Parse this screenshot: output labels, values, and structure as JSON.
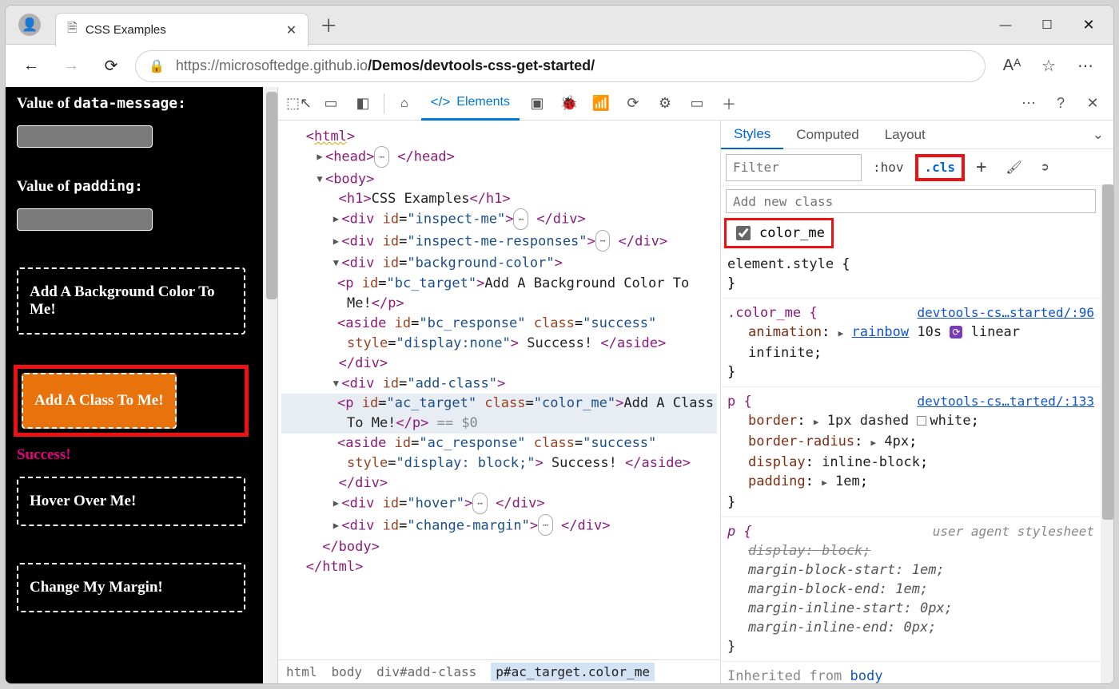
{
  "window": {
    "tab_title": "CSS Examples",
    "minimize_glyph": "—",
    "maximize_glyph": "☐",
    "close_glyph": "✕"
  },
  "addr": {
    "url_host": "https://microsoftedge.github.io",
    "url_path": "/Demos/devtools-css-get-started/",
    "back": "←",
    "forward": "→",
    "refresh": "⟳",
    "lock": "🔒",
    "read": "Aᴬ",
    "star": "☆",
    "menu": "⋯"
  },
  "page": {
    "val_data_message_label_a": "Value of ",
    "val_data_message_label_b": "data-message:",
    "val_padding_label_a": "Value of ",
    "val_padding_label_b": "padding:",
    "bg_box": "Add A Background Color To Me!",
    "class_box": "Add A Class To Me!",
    "success": "Success!",
    "hover_box": "Hover Over Me!",
    "margin_box": "Change My Margin!"
  },
  "devtools": {
    "tabs": {
      "elements": "Elements"
    },
    "breadcrumb": [
      "html",
      "body",
      "div#add-class",
      "p#ac_target.color_me"
    ]
  },
  "dom": {
    "html_open": "<html>",
    "head_open": "<head>",
    "head_close": "</head>",
    "body_open": "<body>",
    "h1": "<h1>CSS Examples</h1>",
    "inspect_me_open": "<div id=\"inspect-me\">",
    "inspect_me_close": "</div>",
    "inspect_resp_open": "<div id=\"inspect-me-responses\">",
    "inspect_resp_close": "</div>",
    "bg_open": "<div id=\"background-color\">",
    "bc_p_open": "<p id=\"bc_target\">",
    "bc_p_text": "Add A Background Color To Me!",
    "bc_p_close": "</p>",
    "bc_aside_open": "<aside id=\"bc_response\" class=\"success\" style=\"display:none\">",
    "bc_aside_text": " Success! ",
    "bc_aside_close": "</aside>",
    "div_close": "</div>",
    "ac_open": "<div id=\"add-class\">",
    "ac_p_open": "<p id=\"ac_target\" class=\"color_me\">",
    "ac_p_text": "Add A Class To Me!",
    "ac_p_close": "</p>",
    "eq0": " == $0",
    "ac_aside_open": "<aside id=\"ac_response\" class=\"success\" style=\"display: block;\">",
    "ac_aside_text": " Success! ",
    "ac_aside_close": "</aside>",
    "hover_open": "<div id=\"hover\">",
    "cm_open": "<div id=\"change-margin\">",
    "body_close": "</body>",
    "html_close": "</html>"
  },
  "styles": {
    "tabs": {
      "styles": "Styles",
      "computed": "Computed",
      "layout": "Layout"
    },
    "filter_placeholder": "Filter",
    "hov": ":hov",
    "cls": ".cls",
    "plus": "+",
    "add_class_placeholder": "Add new class",
    "class_check_label": "color_me",
    "element_style": "element.style {",
    "brace_close": "}",
    "colorme_sel": ".color_me {",
    "colorme_link": "devtools-cs…started/:96",
    "anim_prop": "animation",
    "anim_val_a": "rainbow",
    "anim_val_b": "10s",
    "anim_val_c": "linear infinite",
    "p_sel": "p {",
    "p_link": "devtools-cs…tarted/:133",
    "border_prop": "border",
    "border_val_a": "1px dashed",
    "border_val_b": "white",
    "br_prop": "border-radius",
    "br_val": "4px",
    "disp_prop": "display",
    "disp_val": "inline-block",
    "pad_prop": "padding",
    "pad_val": "1em",
    "p_ua_sel": "p {",
    "ua_note": "user agent stylesheet",
    "ua_display": "display: block;",
    "mbs": "margin-block-start",
    "mbs_v": "1em",
    "mbe": "margin-block-end",
    "mbe_v": "1em",
    "mis": "margin-inline-start",
    "mis_v": "0px",
    "mie": "margin-inline-end",
    "mie_v": "0px",
    "inherited": "Inherited from ",
    "inherited_from": "body"
  }
}
